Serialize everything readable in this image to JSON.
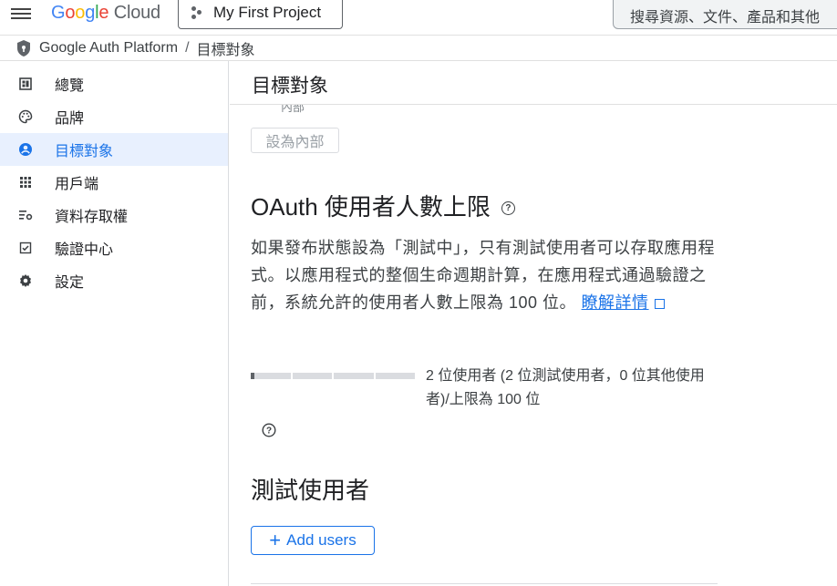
{
  "topbar": {
    "logo_google": [
      "G",
      "o",
      "o",
      "g",
      "l",
      "e"
    ],
    "logo_cloud": "Cloud",
    "project": "My First Project",
    "search_placeholder": "搜尋資源、文件、產品和其他"
  },
  "breadcrumb": {
    "platform": "Google Auth Platform",
    "separator": "/",
    "current": "目標對象"
  },
  "sidebar": {
    "items": [
      {
        "label": "總覽",
        "icon": "dashboard-icon"
      },
      {
        "label": "品牌",
        "icon": "palette-icon"
      },
      {
        "label": "目標對象",
        "icon": "account-circle-icon",
        "active": true
      },
      {
        "label": "用戶端",
        "icon": "apps-grid-icon"
      },
      {
        "label": "資料存取權",
        "icon": "settings-list-icon"
      },
      {
        "label": "驗證中心",
        "icon": "verified-box-icon"
      },
      {
        "label": "設定",
        "icon": "gear-icon"
      }
    ]
  },
  "main": {
    "header": "目標對象",
    "cut_text": "內部",
    "internal_button": "設為內部",
    "oauth_title": "OAuth 使用者人數上限",
    "description": "如果發布狀態設為「測試中」，只有測試使用者可以存取應用程式。以應用程式的整個生命週期計算，在應用程式通過驗證之前，系統允許的使用者人數上限為 100 位。",
    "learn_more": "瞭解詳情",
    "usage_text": "2 位使用者 (2 位測試使用者，0 位其他使用者)/上限為 100 位",
    "usage_fraction": 0.02,
    "test_users_title": "測試使用者",
    "add_users_label": "Add users",
    "add_users_icon": "+"
  },
  "colors": {
    "accent": "#1a73e8",
    "active_bg": "#e8f0fe"
  }
}
